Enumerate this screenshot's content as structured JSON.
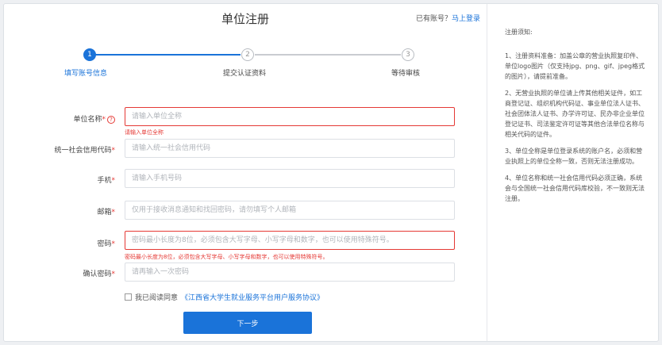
{
  "header": {
    "title": "单位注册",
    "has_account": "已有账号？",
    "login_link": "马上登录"
  },
  "steps": [
    {
      "number": "1",
      "label": "填写账号信息",
      "state": "active"
    },
    {
      "number": "2",
      "label": "提交认证资料",
      "state": "pending"
    },
    {
      "number": "3",
      "label": "等待审核",
      "state": "pending"
    }
  ],
  "form": {
    "org_name": {
      "label": "单位名称",
      "required": "*",
      "help": "?",
      "placeholder": "请输入单位全称",
      "error": "请输入单位全称"
    },
    "credit_code": {
      "label": "统一社会信用代码",
      "required": "*",
      "placeholder": "请输入统一社会信用代码"
    },
    "phone": {
      "label": "手机",
      "required": "*",
      "placeholder": "请输入手机号码"
    },
    "email": {
      "label": "邮箱",
      "required": "*",
      "placeholder": "仅用于接收消息通知和找回密码，请勿填写个人邮箱"
    },
    "password": {
      "label": "密码",
      "required": "*",
      "placeholder": "密码最小长度为8位，必须包含大写字母、小写字母和数字，也可以使用特殊符号。",
      "error": "密码最小长度为8位，必须包含大写字母、小写字母和数字，也可以使用特殊符号。"
    },
    "confirm_password": {
      "label": "确认密码",
      "required": "*",
      "placeholder": "请再输入一次密码"
    },
    "agreement": {
      "prefix": "我已阅读同意",
      "link": "《江西省大学生就业服务平台用户服务协议》"
    },
    "next_label": "下一步"
  },
  "sidebar": {
    "title": "注册须知:",
    "notes": [
      "1、注册资料准备：加盖公章的营业执照复印件、单位logo图片（仅支持jpg、png、gif、jpeg格式的图片），请提前准备。",
      "2、无营业执照的单位请上传其他相关证件，如工商登记证、组织机构代码证、事业单位法人证书、社会团体法人证书、办学许可证、民办非企业单位登记证书、司法鉴定许可证等其他合法单位名称与相关代码的证件。",
      "3、单位全称是单位登录系统的账户名，必须和营业执照上的单位全称一致，否则无法注册成功。",
      "4、单位名称和统一社会信用代码必须正确，系统会与全国统一社会信用代码库校验，不一致则无法注册。"
    ]
  },
  "colors": {
    "accent": "#1a73d9",
    "error": "#e53935",
    "inactive": "#c9ccd1"
  }
}
